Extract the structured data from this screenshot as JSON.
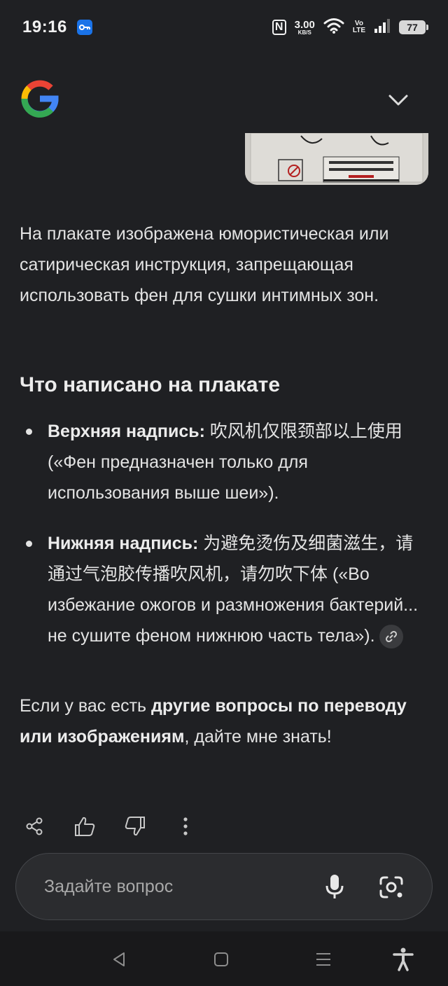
{
  "status_bar": {
    "time": "19:16",
    "net_speed": "3.00",
    "net_unit": "KB/S",
    "volte_top": "Vo",
    "volte_bottom": "LTE",
    "battery": "77",
    "icons": [
      "key-icon",
      "nfc-icon",
      "wifi-icon",
      "signal-icon",
      "battery-icon"
    ]
  },
  "header": {
    "logo": "google-g-logo",
    "collapse_icon": "chevron-down-icon"
  },
  "response": {
    "intro": "На плакате изображена юмористическая или сатирическая инструкция, запрещающая использовать фен для сушки интимных зон.",
    "heading": "Что написано на плакате",
    "bullets": [
      {
        "label": "Верхняя надпись:",
        "text": " 吹风机仅限颈部以上使用 («Фен предназначен только для использования выше шеи»)."
      },
      {
        "label": "Нижняя надпись:",
        "text": " 为避免烫伤及细菌滋生，请通过气泡胶传播吹风机，请勿吹下体 («Во избежание ожогов и размножения бактерий... не сушите феном нижнюю часть тела»)."
      }
    ],
    "outro_prefix": "Если у вас есть ",
    "outro_bold": "другие вопросы по переводу или изображениям",
    "outro_suffix": ", дайте мне знать!"
  },
  "actions": [
    "share-icon",
    "thumbs-up-icon",
    "thumbs-down-icon",
    "more-vert-icon"
  ],
  "input": {
    "placeholder": "Задайте вопрос",
    "icons": [
      "mic-icon",
      "camera-lens-icon"
    ]
  },
  "nav_bar": [
    "back-icon",
    "home-icon",
    "recents-icon",
    "accessibility-icon"
  ],
  "colors": {
    "background": "#1f2023",
    "text": "#e3e3e3",
    "input_bg": "#2b2c2f",
    "accent_blue": "#1a73e8"
  }
}
